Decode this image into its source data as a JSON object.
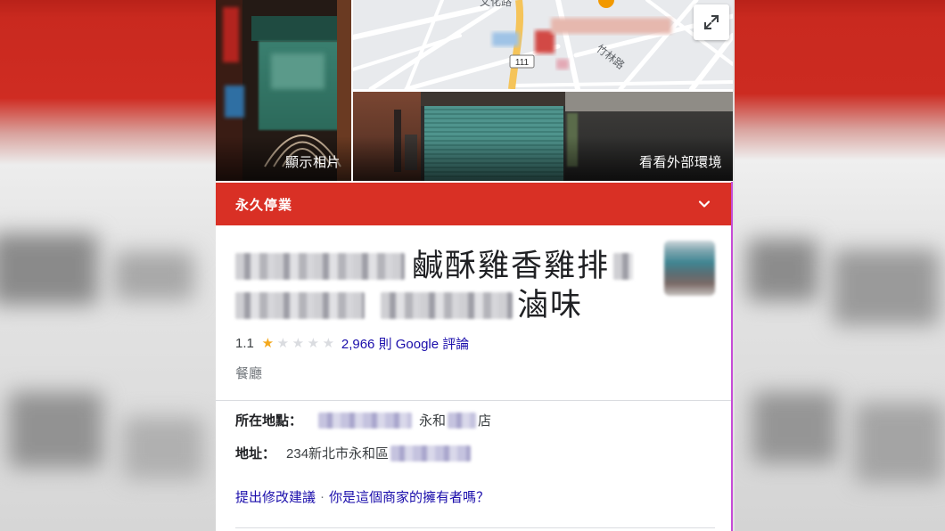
{
  "photos": {
    "show_photos_label": "顯示相片",
    "exterior_label": "看看外部環境"
  },
  "map": {
    "labels": {
      "road_1": "文化路",
      "road_2": "竹林路",
      "route_number": "111"
    },
    "expand_icon": "expand-icon"
  },
  "status_bar": {
    "label": "永久停業",
    "icon": "chevron-down-icon"
  },
  "business": {
    "title_visible_part_1": "鹹酥雞香雞排",
    "title_visible_part_2": "滷味",
    "rating": "1.1",
    "stars_filled": 1,
    "stars_total": 5,
    "reviews": "2,966 則 Google 評論",
    "category": "餐廳"
  },
  "details": {
    "location_label": "所在地點：",
    "location_visible_1": "永和",
    "location_visible_2": "店",
    "address_label": "地址：",
    "address_visible": "234新北市永和區"
  },
  "footer_links": {
    "suggest_edit": "提出修改建議",
    "separator": "·",
    "owner_question": "你是這個商家的擁有者嗎？"
  },
  "colors": {
    "status_red": "#d93025",
    "link_blue": "#1a0dab",
    "star_gold": "#f4a81c",
    "star_empty": "#dadce0"
  }
}
